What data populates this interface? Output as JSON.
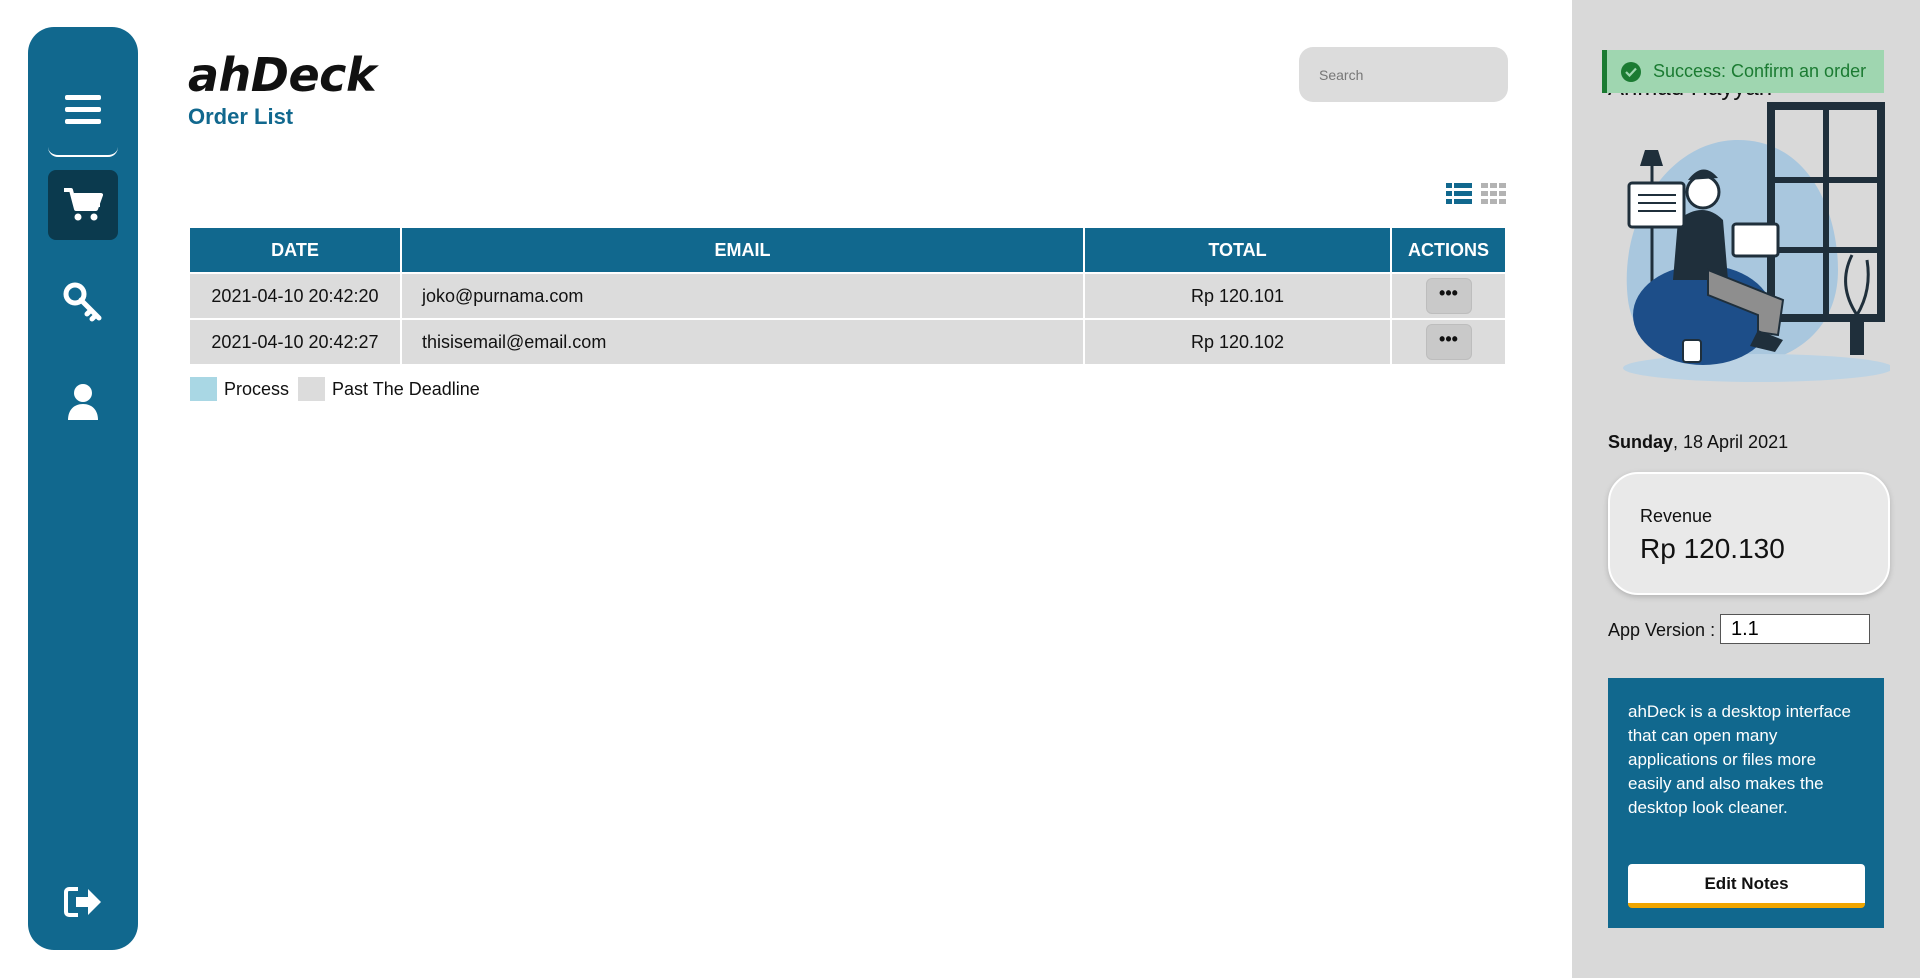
{
  "app": {
    "brand": "ahDeck",
    "page_title": "Order List"
  },
  "sidebar": {
    "items": [
      {
        "icon": "menu-icon"
      },
      {
        "icon": "cart-icon",
        "active": true
      },
      {
        "icon": "key-icon"
      },
      {
        "icon": "user-icon"
      },
      {
        "icon": "logout-icon"
      }
    ]
  },
  "search": {
    "placeholder": "Search"
  },
  "table": {
    "headers": [
      "DATE",
      "EMAIL",
      "TOTAL",
      "ACTIONS"
    ],
    "rows": [
      {
        "date": "2021-04-10 20:42:20",
        "email": "joko@purnama.com",
        "total": "Rp 120.101",
        "action": "•••"
      },
      {
        "date": "2021-04-10 20:42:27",
        "email": "thisisemail@email.com",
        "total": "Rp 120.102",
        "action": "•••"
      }
    ]
  },
  "legend": {
    "process": "Process",
    "past_deadline": "Past The Deadline",
    "process_color": "#a9d7e4",
    "past_deadline_color": "#dcdcdc"
  },
  "right_panel": {
    "username": "Ahmad Hayyan",
    "toast": "Success: Confirm an order",
    "date_day": "Sunday",
    "date_rest": ", 18 April 2021",
    "revenue_label": "Revenue",
    "revenue_value": "Rp 120.130",
    "version_label": "App Version :",
    "version_value": "1.1",
    "notes": "ahDeck is a desktop interface that can open many applications or files more easily and also makes the desktop look cleaner.",
    "edit_button": "Edit Notes"
  },
  "colors": {
    "primary": "#11688e",
    "dark": "#0b3a4e",
    "success": "#1b7b32",
    "accent": "#f0a500"
  }
}
